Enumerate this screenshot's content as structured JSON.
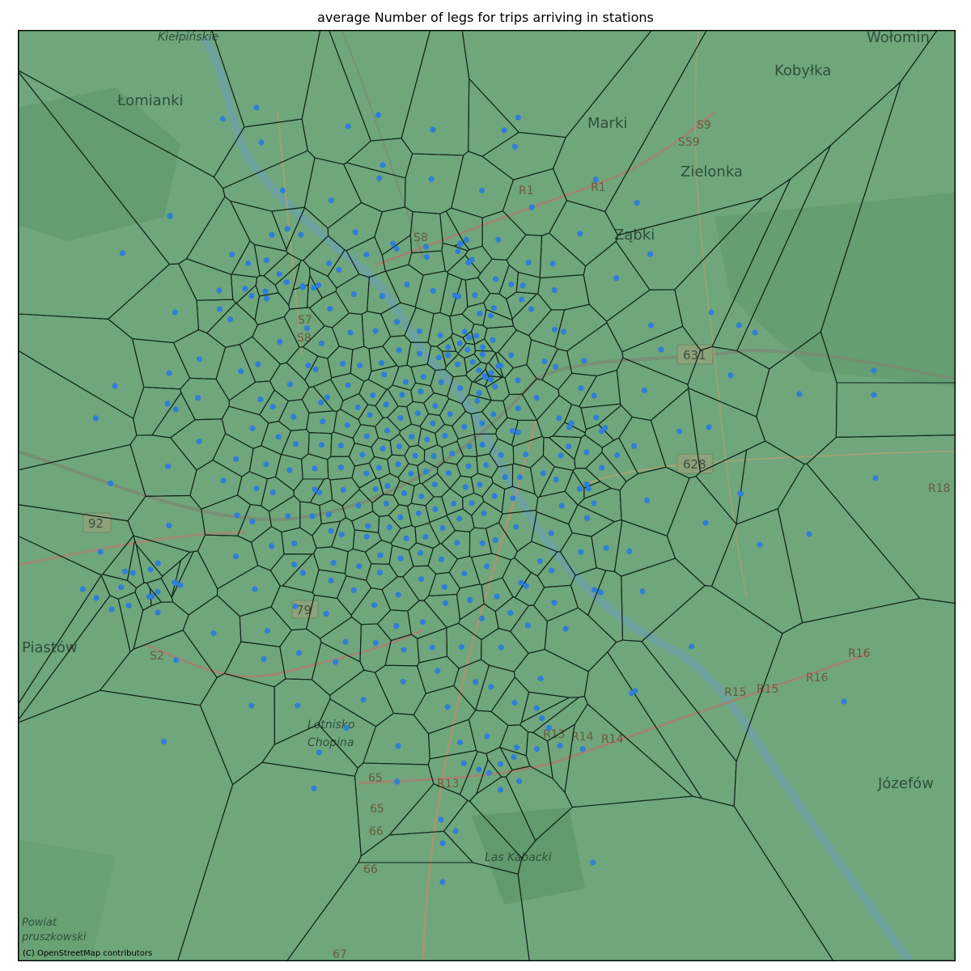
{
  "figure": {
    "title": "average Number of legs for trips arriving in stations",
    "attribution": "(C) OpenStreetMap contributors"
  },
  "map": {
    "basemap_color": "#6fa67c",
    "cell_edge_color": "#0f2418",
    "station_color": "#2f7fd6",
    "places": [
      {
        "name": "Kiełpińskie",
        "size": "small"
      },
      {
        "name": "Łomianki",
        "size": "large"
      },
      {
        "name": "Marki",
        "size": "large"
      },
      {
        "name": "Kobyłka",
        "size": "large"
      },
      {
        "name": "Wołomin",
        "size": "large"
      },
      {
        "name": "Zielonka",
        "size": "large"
      },
      {
        "name": "Ząbki",
        "size": "large"
      },
      {
        "name": "Piastów",
        "size": "large"
      },
      {
        "name": "Lotnisko Chopina",
        "size": "small"
      },
      {
        "name": "Las Kabacki",
        "size": "small"
      },
      {
        "name": "Józefów",
        "size": "large"
      },
      {
        "name": "Powiat pruszkowski",
        "size": "small"
      }
    ],
    "road_labels": [
      "S7",
      "S8",
      "S8",
      "S2",
      "S59",
      "S9",
      "R1",
      "R1",
      "R13",
      "R14",
      "R14",
      "R13",
      "R15",
      "R15",
      "R16",
      "R16",
      "R18",
      "65",
      "65",
      "66",
      "66",
      "67"
    ],
    "road_shields": [
      "631",
      "628",
      "92",
      "79"
    ],
    "cell_count_description": "Voronoi cells around bike-share stations covering Warsaw"
  }
}
